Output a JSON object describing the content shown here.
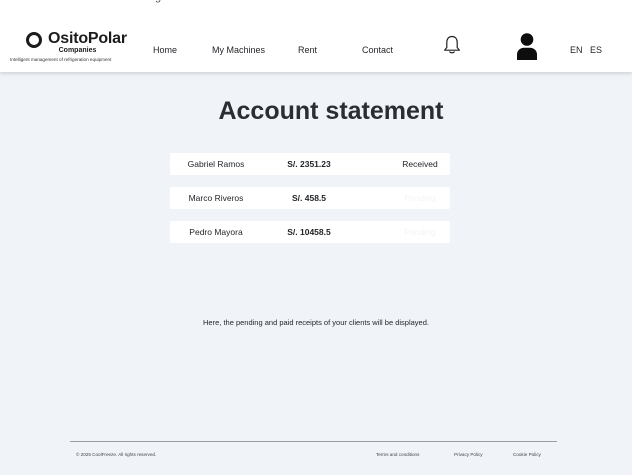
{
  "app": {
    "brand": "OsitoPolar",
    "brand_sub": "Companies",
    "tagline": "Intelligent management of refrigeration equipment"
  },
  "top_strip_text": "g",
  "nav": {
    "items": [
      {
        "label": "Home"
      },
      {
        "label": "My Machines"
      },
      {
        "label": "Rent"
      },
      {
        "label": "Contact"
      }
    ],
    "icons": [
      "bell-icon",
      "user-icon"
    ],
    "languages": [
      "EN",
      "ES"
    ]
  },
  "page": {
    "title": "Account statement",
    "rows": [
      {
        "name": "Gabriel Ramos",
        "amount": "S/. 2351.23",
        "status": "Received",
        "status_color": "#1f2226"
      },
      {
        "name": "Marco Riveros",
        "amount": "S/. 458.5",
        "status": "Pending",
        "status_color": "#f3f4f6"
      },
      {
        "name": "Pedro Mayora",
        "amount": "S/. 10458.5",
        "status": "Pending",
        "status_color": "#f3f4f6"
      }
    ],
    "note": "Here, the pending and paid receipts of your clients will be displayed."
  },
  "footer": {
    "copyright": "© 2025 CoolFreeze. All rights reserved.",
    "links": [
      {
        "label": "Terms and conditions"
      },
      {
        "label": "Privacy Policy"
      },
      {
        "label": "Cookie Policy"
      }
    ]
  },
  "colors": {
    "background": "#f0f3f8",
    "surface": "#ffffff",
    "text": "#1f2226",
    "pending_text": "#f3f4f6"
  }
}
